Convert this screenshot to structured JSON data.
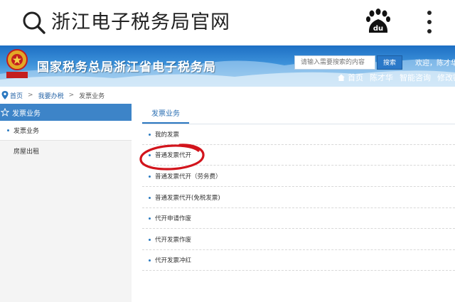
{
  "browser": {
    "url_text": "浙江电子税务局官网"
  },
  "banner": {
    "site_title": "国家税务总局浙江省电子税务局",
    "search_placeholder": "请输入需要搜索的内容",
    "search_button": "搜索",
    "welcome": "欢迎，陈才华",
    "nav": {
      "home": "首页",
      "user": "陈才华",
      "smart_consult": "智能咨询",
      "change_password": "修改密码"
    }
  },
  "breadcrumb": {
    "home": "首页",
    "sep1": ">",
    "section": "我要办税",
    "sep2": ">",
    "current": "发票业务"
  },
  "sidebar": {
    "header": "发票业务",
    "items": [
      {
        "label": "发票业务"
      },
      {
        "label": "房屋出租"
      }
    ]
  },
  "content": {
    "tab": "发票业务",
    "items": [
      {
        "label": "我的发票"
      },
      {
        "label": "普通发票代开"
      },
      {
        "label": "普通发票代开（劳务费）"
      },
      {
        "label": "普通发票代开(免税发票)"
      },
      {
        "label": "代开申请作废"
      },
      {
        "label": "代开发票作废"
      },
      {
        "label": "代开发票冲红"
      }
    ]
  },
  "colors": {
    "banner_blue": "#2a7fd0",
    "sidebar_header": "#3d84c8",
    "link_blue": "#2563a6",
    "annotation_red": "#d2141c"
  }
}
